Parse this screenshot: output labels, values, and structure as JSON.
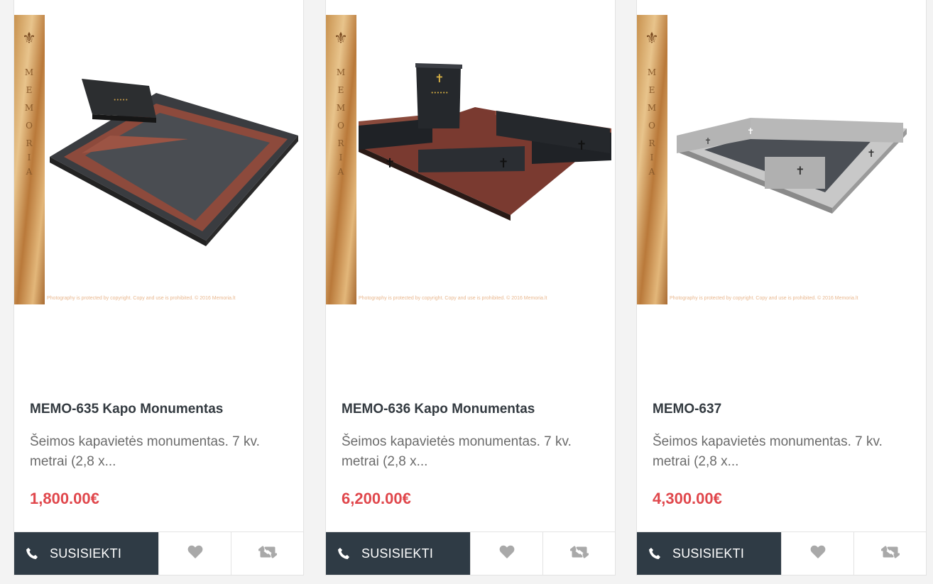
{
  "products": [
    {
      "title": "MEMO-635 Kapo Monumentas",
      "description": "Šeimos kapavietės monumentas. 7 kv. metrai (2,8 x...",
      "price": "1,800.00€",
      "contact_label": "SUSISIEKTI",
      "image_watermark": "Photography is protected by copyright. Copy and use is prohibited. © 2016 Memoria.lt",
      "icons": {
        "contact": "phone-icon",
        "wishlist": "heart-icon",
        "compare": "retweet-icon"
      }
    },
    {
      "title": "MEMO-636 Kapo Monumentas",
      "description": "Šeimos kapavietės monumentas. 7 kv. metrai (2,8 x...",
      "price": "6,200.00€",
      "contact_label": "SUSISIEKTI",
      "image_watermark": "Photography is protected by copyright. Copy and use is prohibited. © 2016 Memoria.lt",
      "icons": {
        "contact": "phone-icon",
        "wishlist": "heart-icon",
        "compare": "retweet-icon"
      }
    },
    {
      "title": "MEMO-637",
      "description": "Šeimos kapavietės monumentas. 7 kv. metrai (2,8 x...",
      "price": "4,300.00€",
      "contact_label": "SUSISIEKTI",
      "image_watermark": "Photography is protected by copyright. Copy and use is prohibited. © 2016 Memoria.lt",
      "icons": {
        "contact": "phone-icon",
        "wishlist": "heart-icon",
        "compare": "retweet-icon"
      }
    }
  ],
  "colors": {
    "price": "#e0474c",
    "contact_button_bg": "#2f3b45",
    "title": "#333a40",
    "description": "#6b6b6b",
    "icon_gray": "#a9a9a9"
  }
}
